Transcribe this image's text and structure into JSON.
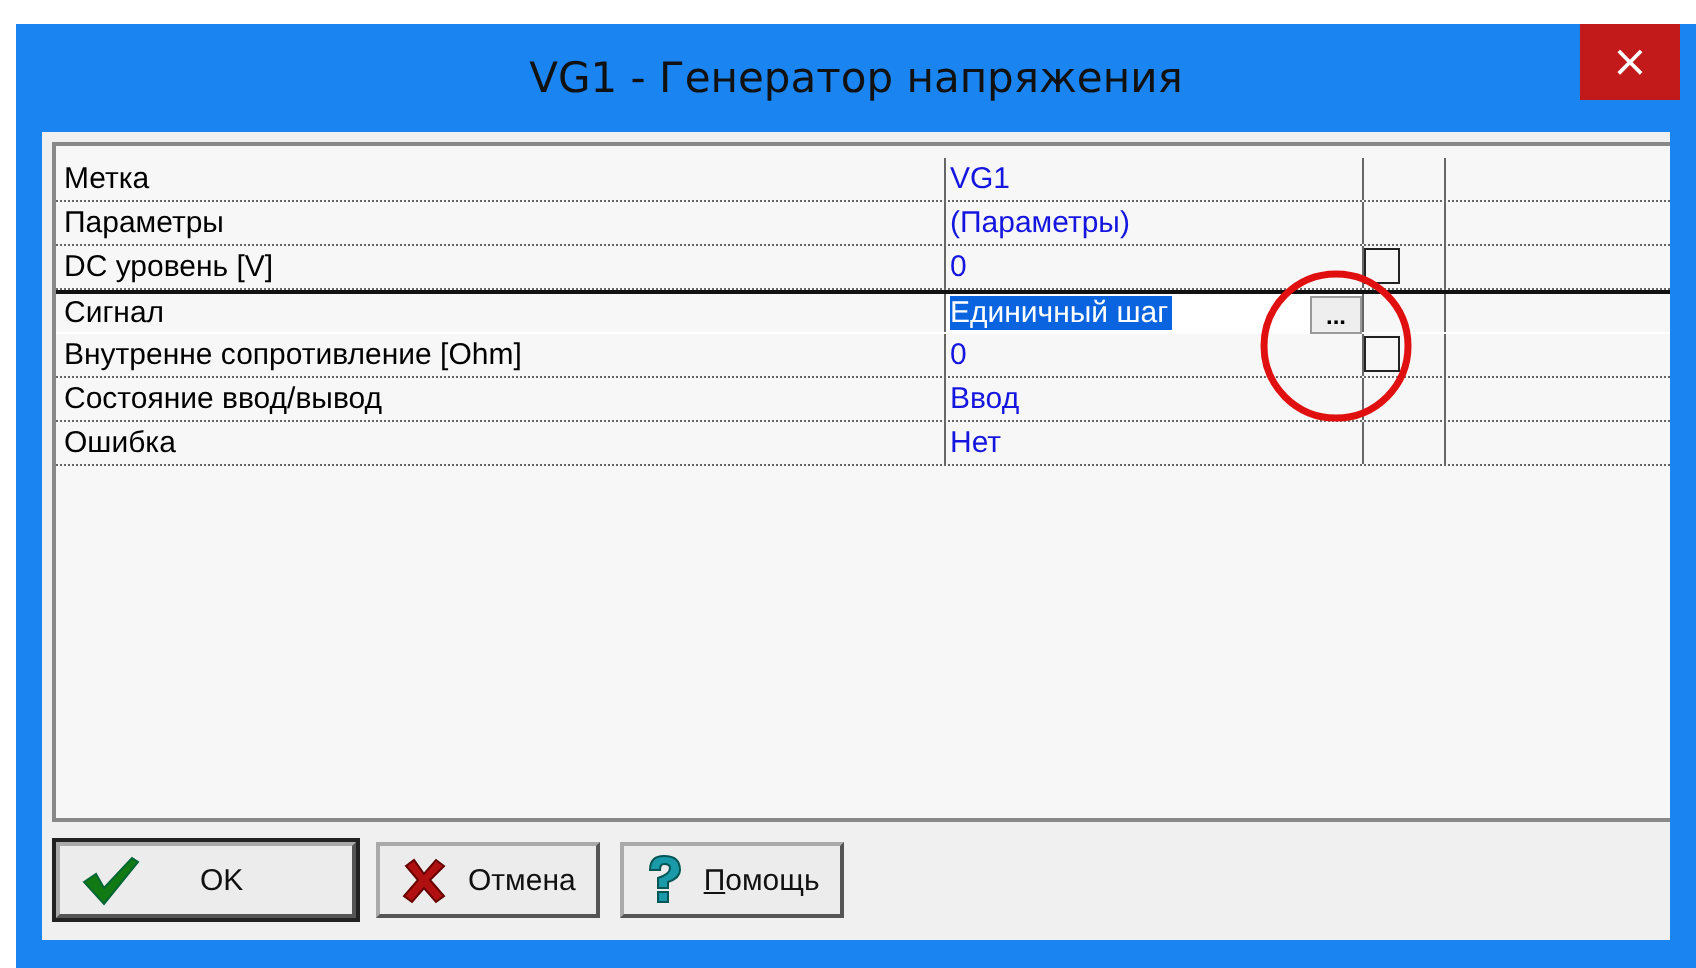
{
  "window": {
    "title": "VG1 - Генератор напряжения",
    "close": "×"
  },
  "properties": [
    {
      "name": "Метка",
      "value": "VG1",
      "kind": "plain",
      "selected": false
    },
    {
      "name": "Параметры",
      "value": "(Параметры)",
      "kind": "plain",
      "selected": false
    },
    {
      "name": "DC уровень [V]",
      "value": "0",
      "kind": "box",
      "checked": false,
      "selected": false
    },
    {
      "name": "Сигнал",
      "value": "Единичный шаг",
      "kind": "plain",
      "selected": true,
      "editor_button": "..."
    },
    {
      "name": "Внутренне сопротивление [Ohm]",
      "value": "0",
      "kind": "box",
      "checked": false,
      "selected": false
    },
    {
      "name": "Состояние ввод/вывод",
      "value": "Ввод",
      "kind": "plain",
      "selected": false
    },
    {
      "name": "Ошибка",
      "value": "Нет",
      "kind": "plain",
      "selected": false
    }
  ],
  "buttons": [
    {
      "label": "OK",
      "kind": "ok",
      "default": true
    },
    {
      "label": "Отмена",
      "kind": "cancel",
      "default": false
    },
    {
      "label": "Помощь",
      "kind": "help",
      "default": false,
      "first_letter_underlined": true
    }
  ]
}
